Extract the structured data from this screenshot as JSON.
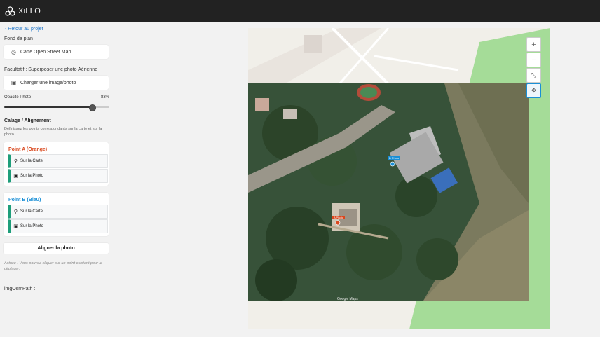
{
  "app": {
    "name": "XiLLO"
  },
  "sidebar": {
    "back_label": "Retour au projet",
    "basemap_label": "Fond de plan",
    "basemap_button": "Carte Open Street Map",
    "optional_label": "Facultatif : Superposer une photo Aérienne",
    "upload_button": "Charger une image/photo",
    "opacity_label": "Opacité Photo",
    "opacity_text": "83%",
    "opacity_value": 0.83,
    "calibration_title": "Calage / Alignement",
    "calibration_desc": "Définissez les points correspondants sur la carte et sur la photo.",
    "point_a": {
      "title": "Point A (Orange)",
      "color": "#d9481e",
      "on_map": "Sur la Carte",
      "on_photo": "Sur la Photo"
    },
    "point_b": {
      "title": "Point B (Bleu)",
      "color": "#1a8fd6",
      "on_map": "Sur la Carte",
      "on_photo": "Sur la Photo"
    },
    "align_button": "Aligner la photo",
    "hint": "Astuce : Vous pouvez cliquer sur un point existant pour le déplacer.",
    "img_path_label": "imgOsmPath :"
  },
  "map": {
    "controls": [
      "zoom-in",
      "zoom-out",
      "collapse",
      "move"
    ],
    "zoom_in_label": "+",
    "zoom_out_label": "−",
    "marker_a_label": "A Photo",
    "marker_b_label": "B Photo",
    "attribution": "Google Maps",
    "accent": "#1a8fd6"
  }
}
